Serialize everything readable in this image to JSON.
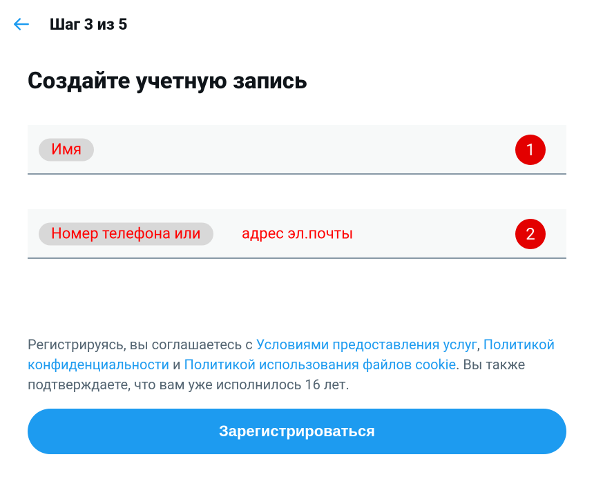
{
  "header": {
    "step_label": "Шаг 3 из 5"
  },
  "title": "Создайте учетную запись",
  "inputs": {
    "name": {
      "label": "Имя",
      "badge": "1"
    },
    "contact": {
      "label_prefix": "Номер телефона или",
      "label_suffix": "адрес эл.почты",
      "badge": "2"
    }
  },
  "disclaimer": {
    "text_start": "Регистрируясь, вы соглашаетесь с  ",
    "link_terms": "Условиями предоставления услуг",
    "sep1": ", ",
    "link_privacy": "Политикой конфиденциальности",
    "sep2": " и ",
    "link_cookie": "Политикой использования файлов cookie",
    "text_end": ". Вы также подтверждаете, что вам уже исполнилось 16 лет."
  },
  "register_button": "Зарегистрироваться"
}
